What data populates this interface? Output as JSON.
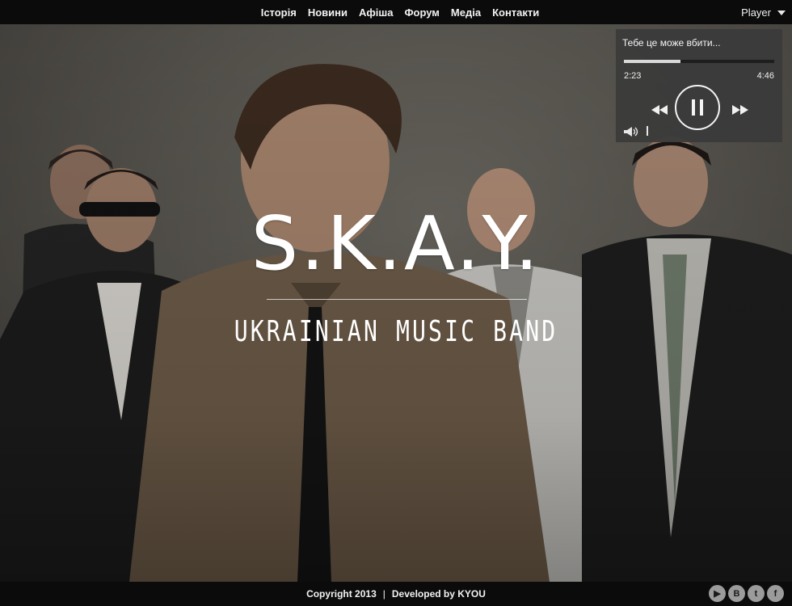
{
  "nav": {
    "items": [
      {
        "label": "Історія"
      },
      {
        "label": "Новини"
      },
      {
        "label": "Афіша"
      },
      {
        "label": "Форум"
      },
      {
        "label": "Медіа"
      },
      {
        "label": "Контакти"
      }
    ],
    "player_label": "Player"
  },
  "hero": {
    "title": "S.K.A.Y.",
    "subtitle": "UKRAINIAN MUSIC BAND"
  },
  "player": {
    "track_title": "Тебе це може вбити...",
    "elapsed": "2:23",
    "total": "4:46",
    "progress_fraction": 0.375
  },
  "footer": {
    "copyright": "Copyright 2013",
    "separator": "|",
    "developed": "Developed by KYOU",
    "social": [
      {
        "icon": "youtube-icon",
        "glyph": "▶"
      },
      {
        "icon": "vk-icon",
        "glyph": "B"
      },
      {
        "icon": "twitter-icon",
        "glyph": "t"
      },
      {
        "icon": "facebook-icon",
        "glyph": "f"
      }
    ]
  },
  "colors": {
    "bar_background": "#0b0b0b",
    "player_background": "#3a3a3a",
    "text": "#ffffff"
  }
}
